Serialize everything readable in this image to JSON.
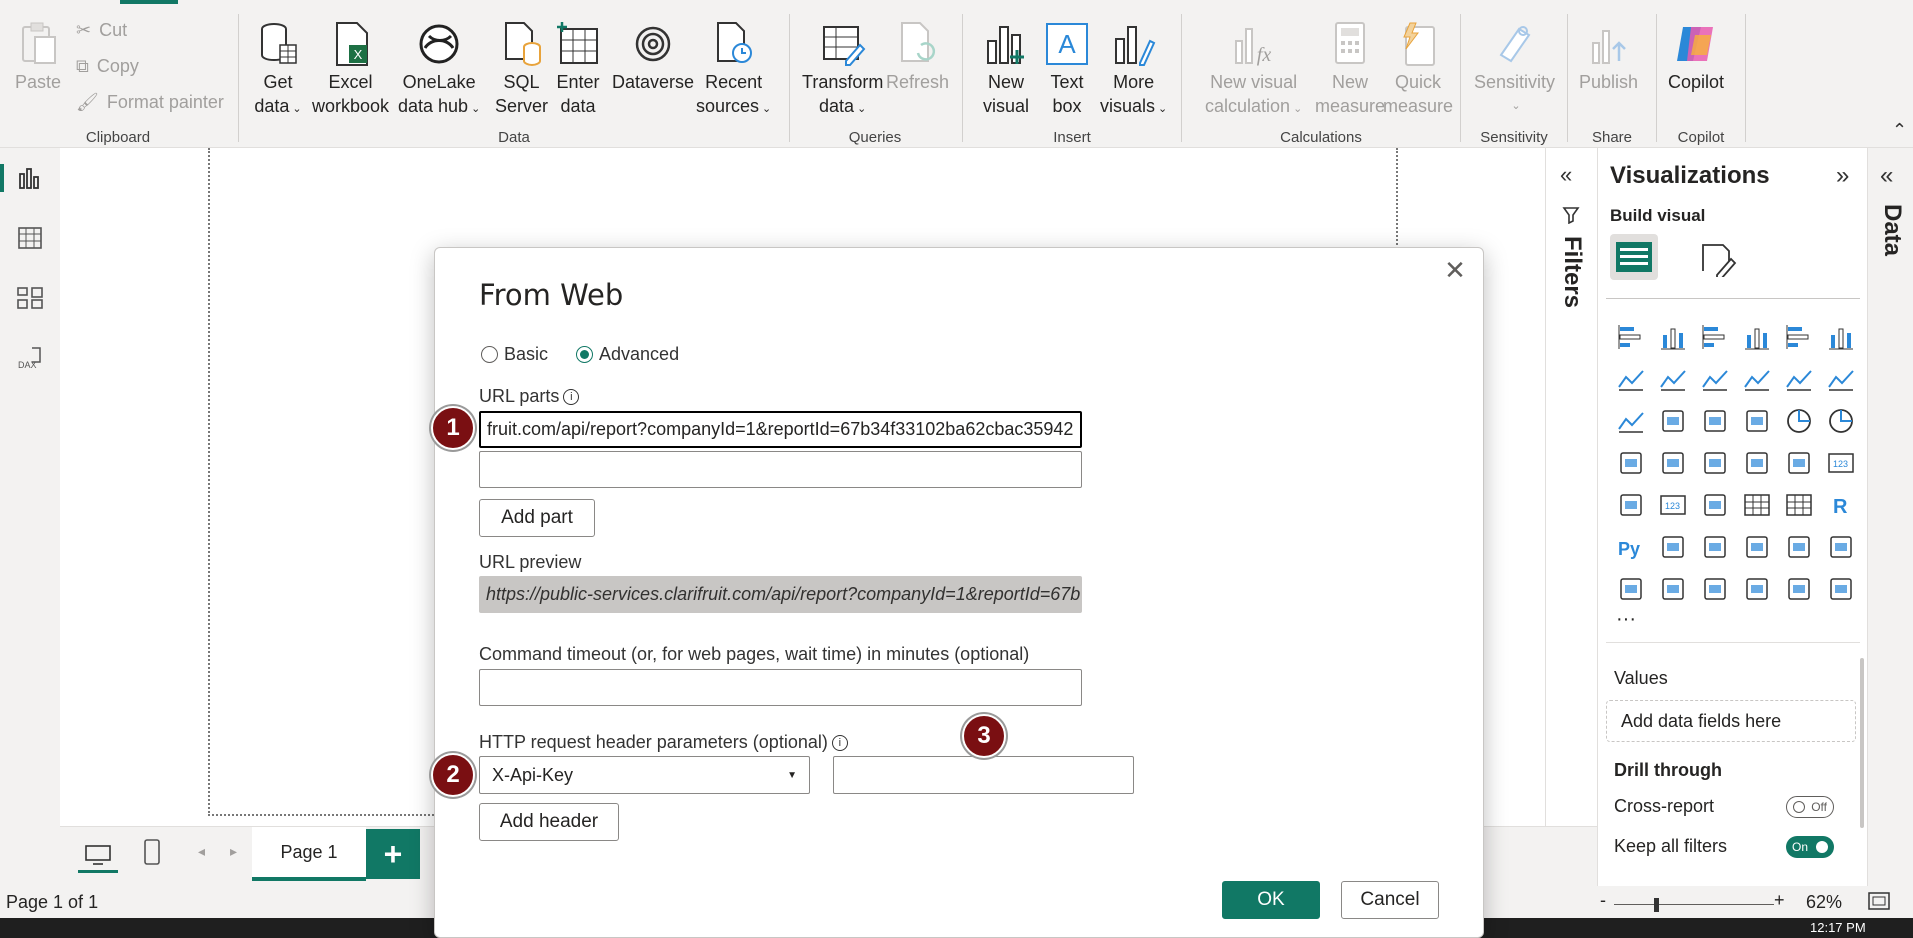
{
  "ribbon": {
    "clipboard": {
      "label": "Clipboard",
      "paste": "Paste",
      "cut": "Cut",
      "copy": "Copy",
      "format_painter": "Format painter"
    },
    "data": {
      "label": "Data",
      "get_data": [
        "Get",
        "data"
      ],
      "excel": [
        "Excel",
        "workbook"
      ],
      "onelake": [
        "OneLake",
        "data hub"
      ],
      "sql": [
        "SQL",
        "Server"
      ],
      "enter": [
        "Enter",
        "data"
      ],
      "dataverse": "Dataverse",
      "recent": [
        "Recent",
        "sources"
      ]
    },
    "queries": {
      "label": "Queries",
      "transform": [
        "Transform",
        "data"
      ],
      "refresh": "Refresh"
    },
    "insert": {
      "label": "Insert",
      "new_visual": [
        "New",
        "visual"
      ],
      "text_box": [
        "Text",
        "box"
      ],
      "more_visuals": [
        "More",
        "visuals"
      ]
    },
    "calculations": {
      "label": "Calculations",
      "new_visual_calc": [
        "New visual",
        "calculation"
      ],
      "new_measure": [
        "New",
        "measure"
      ],
      "quick_measure": [
        "Quick",
        "measure"
      ]
    },
    "sensitivity": {
      "label": "Sensitivity",
      "button": "Sensitivity"
    },
    "share": {
      "label": "Share",
      "publish": "Publish"
    },
    "copilot": {
      "label": "Copilot",
      "button": "Copilot"
    }
  },
  "filters": {
    "label": "Filters"
  },
  "visualizations": {
    "title": "Visualizations",
    "build_visual": "Build visual",
    "more": "···",
    "values_label": "Values",
    "values_placeholder": "Add data fields here",
    "drill_through": "Drill through",
    "cross_report": "Cross-report",
    "cross_report_state": "Off",
    "keep_filters": "Keep all filters",
    "keep_filters_state": "On"
  },
  "data_pane": {
    "label": "Data"
  },
  "pages": {
    "page1": "Page 1",
    "add": "+"
  },
  "status": {
    "page_info": "Page 1 of 1",
    "zoom": "62%",
    "minus": "-",
    "plus": "+"
  },
  "taskbar": {
    "clock": "12:17 PM"
  },
  "dialog": {
    "title": "From Web",
    "radio_basic": "Basic",
    "radio_advanced": "Advanced",
    "url_parts_label": "URL parts",
    "url_part1": "fruit.com/api/report?companyId=1&reportId=67b34f33102ba62cbac35942",
    "url_part2": "",
    "add_part": "Add part",
    "url_preview_label": "URL preview",
    "url_preview": "https://public-services.clarifruit.com/api/report?companyId=1&reportId=67b",
    "timeout_label": "Command timeout (or, for web pages, wait time) in minutes (optional)",
    "timeout_value": "",
    "headers_label": "HTTP request header parameters (optional)",
    "header_name": "X-Api-Key",
    "header_value": "",
    "add_header": "Add header",
    "ok": "OK",
    "cancel": "Cancel"
  },
  "callouts": [
    "1",
    "2",
    "3"
  ],
  "colors": {
    "accent": "#117865",
    "callout": "#7a0f12"
  }
}
